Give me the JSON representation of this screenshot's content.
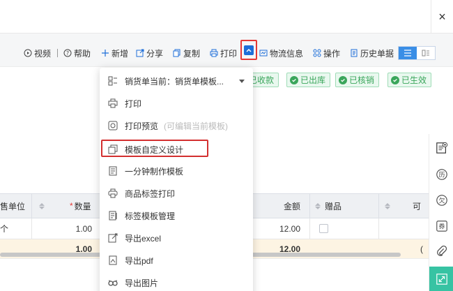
{
  "window": {
    "close_glyph": "×"
  },
  "toolbar": {
    "video": "视频",
    "help": "帮助",
    "add": "新增",
    "share": "分享",
    "copy": "复制",
    "print": "打印",
    "logistics": "物流信息",
    "operate": "操作",
    "history": "历史单据"
  },
  "status_badges": [
    "已收款",
    "已出库",
    "已核销",
    "已生效"
  ],
  "table": {
    "headers": {
      "unit": "售单位",
      "qty": "数量",
      "amount": "金额",
      "gift": "赠品",
      "last": "可"
    },
    "required_mark": "*",
    "row1": {
      "unit": "个",
      "qty": "1.00",
      "amount": "12.00"
    },
    "total": {
      "qty": "1.00",
      "amount": "12.00",
      "last": "("
    }
  },
  "menu": {
    "template_select": "销货单当前：销货单模板...",
    "items": [
      {
        "label": "打印",
        "icon": "printer-icon"
      },
      {
        "label": "打印预览",
        "hint": "(可编辑当前模板)",
        "icon": "preview-icon"
      },
      {
        "label": "模板自定义设计",
        "icon": "template-design-icon"
      },
      {
        "label": "一分钟制作模板",
        "icon": "quick-template-icon"
      },
      {
        "label": "商品标签打印",
        "icon": "label-print-icon"
      },
      {
        "label": "标签模板管理",
        "icon": "label-manage-icon"
      },
      {
        "label": "导出excel",
        "icon": "export-excel-icon"
      },
      {
        "label": "导出pdf",
        "icon": "export-pdf-icon"
      },
      {
        "label": "导出图片",
        "icon": "export-image-icon"
      }
    ]
  },
  "rightbar": {
    "history_glyph": "历",
    "owe_glyph": "欠",
    "coupon_glyph": "券"
  },
  "colors": {
    "accent": "#1e6fd9",
    "highlight_red": "#e53935",
    "success": "#3aa65b",
    "active_side": "#37c3a3"
  }
}
